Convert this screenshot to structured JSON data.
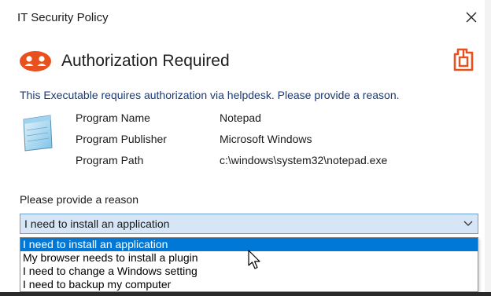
{
  "window": {
    "title": "IT Security Policy",
    "close_glyph": "✕"
  },
  "header": {
    "icon": "person-shield-icon",
    "title": "Authorization Required",
    "brand_icon": "brand-logo-icon",
    "accent_color": "#e8501e"
  },
  "info_text": "This Executable requires authorization via helpdesk. Please provide a reason.",
  "program": {
    "icon": "notepad-icon",
    "rows": [
      {
        "label": "Program Name",
        "value": "Notepad"
      },
      {
        "label": "Program Publisher",
        "value": "Microsoft Windows"
      },
      {
        "label": "Program Path",
        "value": "c:\\windows\\system32\\notepad.exe"
      }
    ]
  },
  "reason": {
    "label": "Please provide a reason",
    "selected": "I need to install an application",
    "options": [
      "I need to install an application",
      "My browser needs to install a plugin",
      "I need to change a Windows setting",
      "I need to backup my computer"
    ],
    "highlight_color": "#0078d7"
  }
}
